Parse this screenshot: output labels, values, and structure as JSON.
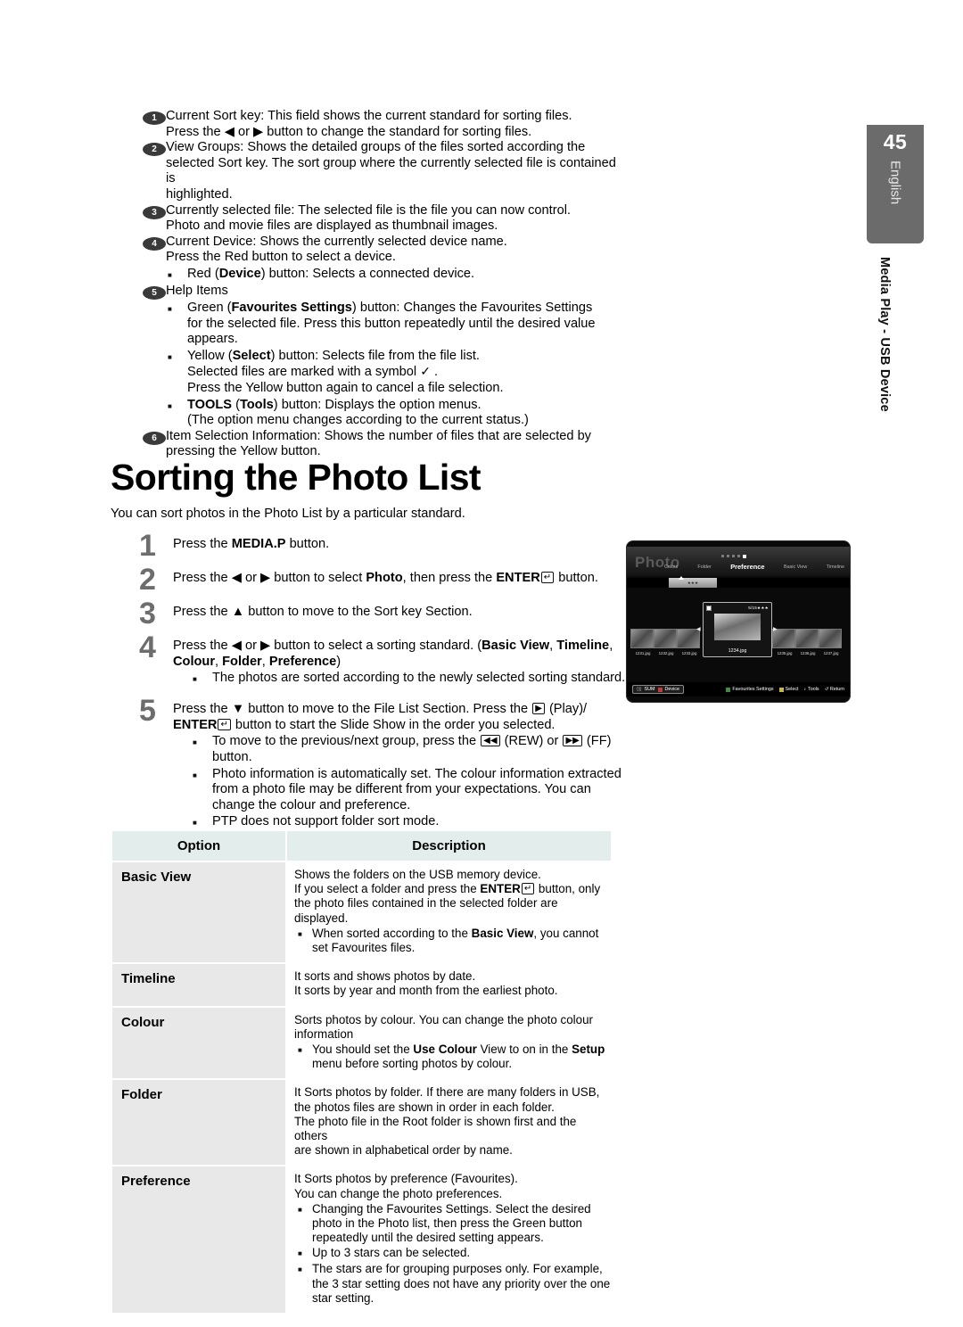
{
  "page": {
    "number": "45",
    "language": "English",
    "chapter": "Media Play - USB Device"
  },
  "callouts": [
    {
      "num": "1",
      "lines": [
        "Current Sort key: This field shows the current standard for sorting files.",
        "Press the ◀ or ▶ button to change the standard for sorting files."
      ],
      "subs": []
    },
    {
      "num": "2",
      "lines": [
        "View Groups: Shows the detailed groups of the files sorted according the",
        "selected Sort key. The sort group where the currently selected file is contained is",
        "highlighted."
      ],
      "subs": []
    },
    {
      "num": "3",
      "lines": [
        "Currently selected file: The selected file is the file you can now control.",
        "Photo and movie files are displayed as thumbnail images."
      ],
      "subs": []
    },
    {
      "num": "4",
      "lines": [
        "Current Device: Shows the currently selected device name.",
        "Press the Red button to select a device."
      ],
      "subs": [
        "Red (Device) button: Selects a connected device."
      ]
    },
    {
      "num": "5",
      "lines": [
        "Help Items"
      ],
      "subs": []
    },
    {
      "num": "6",
      "lines": [
        "Item Selection Information: Shows the number of files that are selected by",
        "pressing the Yellow button."
      ],
      "subs": []
    }
  ],
  "help_items": [
    [
      "Green (Favourites Settings) button: Changes the Favourites Settings",
      "for the selected file. Press this button repeatedly until the desired value",
      "appears."
    ],
    [
      "Yellow (Select) button: Selects file from the file list.",
      "Selected files are marked with a symbol ✓ .",
      "Press the Yellow button again to cancel a file selection."
    ],
    [
      "TOOLS (Tools) button: Displays the option menus.",
      "(The option menu changes according to the current status.)"
    ]
  ],
  "title": "Sorting the Photo List",
  "intro": "You can sort photos in the Photo List by a particular standard.",
  "steps": [
    {
      "num": "1",
      "lines": [
        "Press the MEDIA.P button."
      ],
      "subs": []
    },
    {
      "num": "2",
      "lines": [
        "Press the ◀ or ▶ button to select Photo, then press the ENTER ↵ button."
      ],
      "subs": []
    },
    {
      "num": "3",
      "lines": [
        "Press the ▲ button to move to the Sort key Section."
      ],
      "subs": []
    },
    {
      "num": "4",
      "lines": [
        "Press the ◀ or ▶ button to select a sorting standard. (Basic View, Timeline,",
        "Colour, Folder, Preference)"
      ],
      "subs": [
        "The photos are sorted according to the newly selected sorting standard."
      ]
    },
    {
      "num": "5",
      "lines": [
        "Press the ▼ button to move to the File List Section. Press the ▶ (Play)/",
        "ENTER ↵ button to start the Slide Show in the order you selected."
      ],
      "subs": [
        "To move to the previous/next group, press the ◀◀ (REW) or ▶▶ (FF) button.",
        "Photo information is automatically set. The colour information extracted from a photo file may be different from your expectations. You can change the colour and preference.",
        "PTP does not support folder sort mode."
      ]
    }
  ],
  "table": {
    "headers": [
      "Option",
      "Description"
    ],
    "rows": [
      {
        "option": "Basic View",
        "lines": [
          "Shows the folders on the USB memory device.",
          "If you select a folder and press the ENTER ↵ button, only",
          "the photo files contained in the selected folder are displayed."
        ],
        "subs": [
          "When sorted according to the Basic View, you cannot set Favourites files."
        ]
      },
      {
        "option": "Timeline",
        "lines": [
          "It sorts and shows photos by date.",
          "It sorts by year and month from the earliest photo."
        ],
        "subs": []
      },
      {
        "option": "Colour",
        "lines": [
          "Sorts photos by colour. You can change the photo colour",
          "information"
        ],
        "subs": [
          "You should set the Use Colour View to on in the Setup menu before sorting photos by colour."
        ]
      },
      {
        "option": "Folder",
        "lines": [
          "It Sorts photos by folder. If there are many folders in USB,",
          "the photos files are shown in order in each folder.",
          "The photo file in the Root folder is shown first and the others",
          "are shown in alphabetical order by name."
        ],
        "subs": []
      },
      {
        "option": "Preference",
        "lines": [
          "It Sorts photos by preference (Favourites).",
          "You can change the photo preferences."
        ],
        "subs": [
          "Changing the Favourites Settings. Select the desired photo in the Photo list, then press the Green button repeatedly until the desired setting appears.",
          "Up to 3 stars can be selected.",
          "The stars are for grouping purposes only. For example, the 3 star setting does not have any priority over the one star setting."
        ]
      }
    ]
  },
  "tv": {
    "logo": "Photo",
    "tabs": [
      "Colour",
      "Folder",
      "Preference",
      "Basic View",
      "Timeline"
    ],
    "selected_tab": "Preference",
    "group_label": "★★★",
    "thumbnails": [
      {
        "name": "1231.jpg"
      },
      {
        "name": "1232.jpg"
      },
      {
        "name": "1233.jpg"
      },
      {
        "name": "1235.jpg"
      },
      {
        "name": "1236.jpg"
      },
      {
        "name": "1237.jpg"
      }
    ],
    "selected_file": {
      "name": "1234.jpg",
      "counter": "5/15",
      "stars": "★★★"
    },
    "device": {
      "usb": "SUM",
      "button_label": "Device"
    },
    "help": [
      "Favourites Settings",
      "Select",
      "Tools",
      "Return"
    ]
  }
}
